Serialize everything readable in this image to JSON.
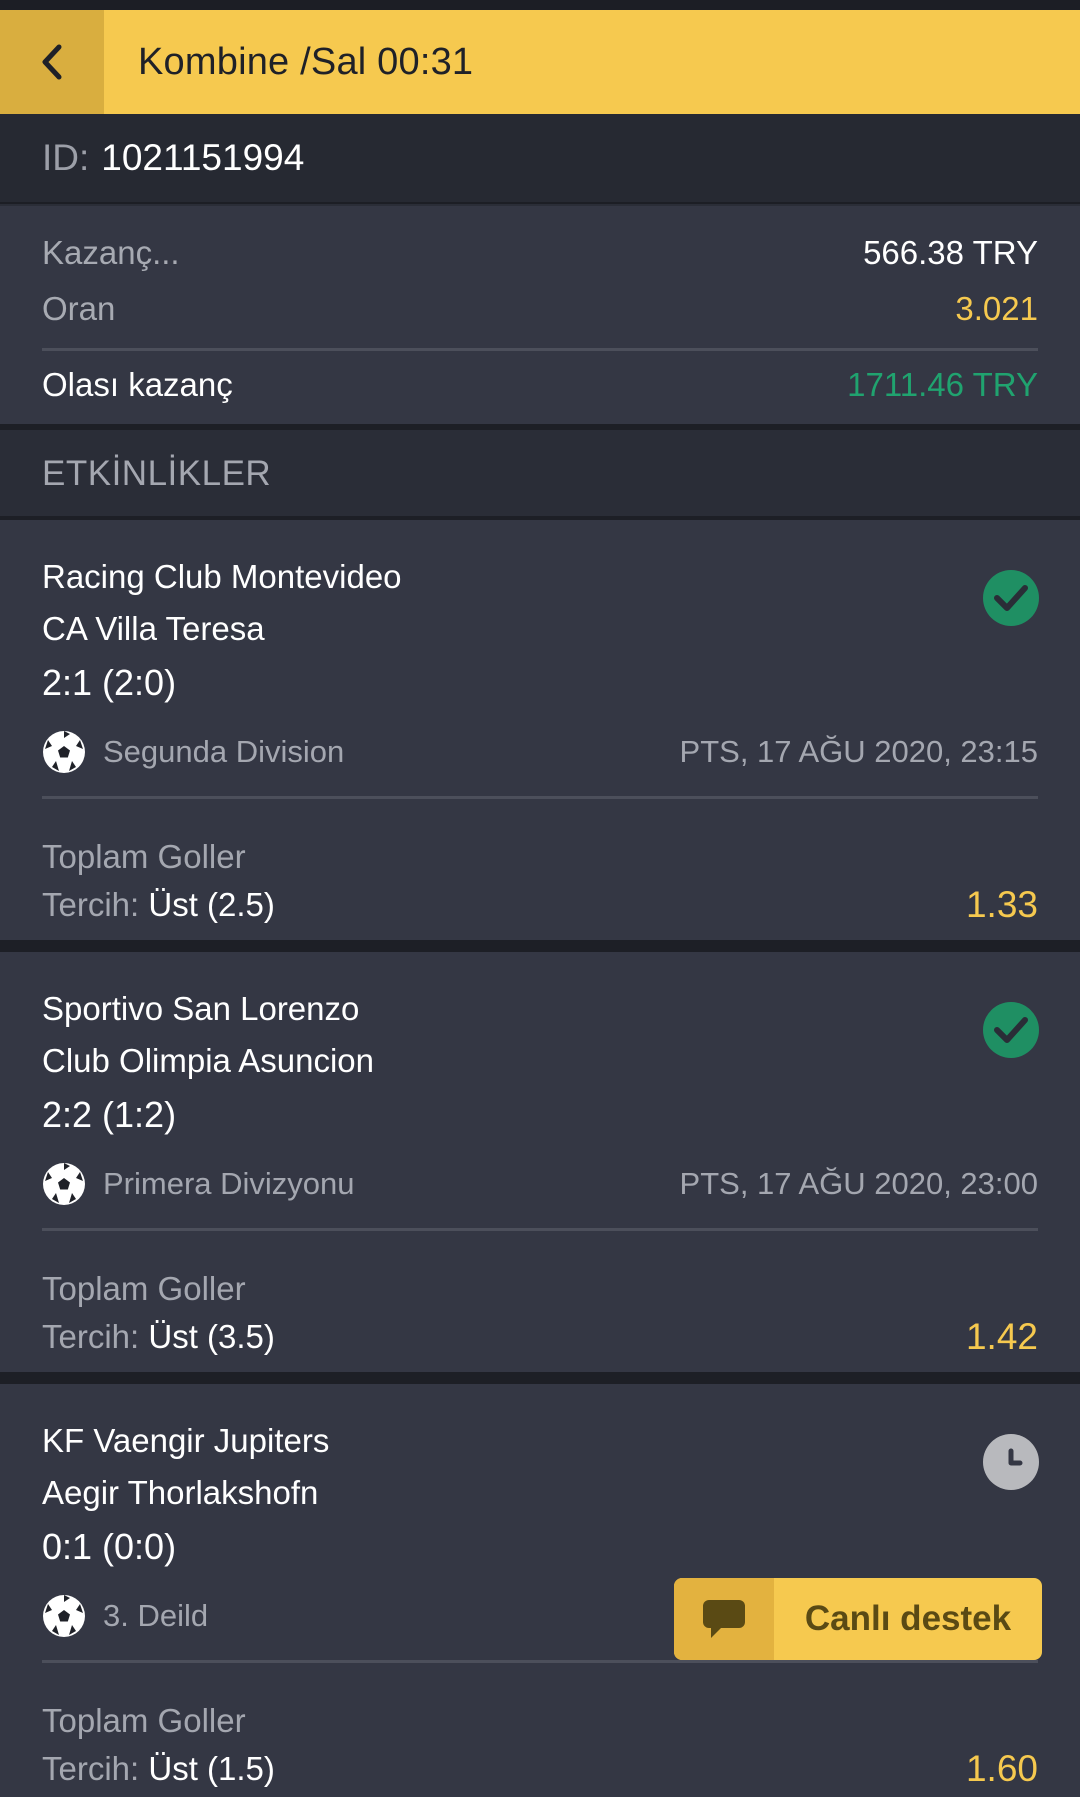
{
  "header": {
    "title": "Kombine /Sal 00:31",
    "back_icon": "chevron-left-icon"
  },
  "ticket": {
    "id_label": "ID:",
    "id_value": "1021151994"
  },
  "summary": {
    "stake_label": "Kazanç...",
    "stake_value": "566.38 TRY",
    "odds_label": "Oran",
    "odds_value": "3.021",
    "potential_label": "Olası kazanç",
    "potential_value": "1711.46 TRY"
  },
  "events_header": "ETKİNLİKLER",
  "events": [
    {
      "home": "Racing Club Montevideo",
      "away": "CA Villa Teresa",
      "score": "2:1 (2:0)",
      "status": "won",
      "status_icon": "check-icon",
      "sport_icon": "soccer-ball-icon",
      "league": "Segunda Division",
      "date": "PTS, 17 AĞU 2020, 23:15",
      "market": "Toplam Goller",
      "pick_label": "Tercih:",
      "pick_value": "Üst (2.5)",
      "odd": "1.33"
    },
    {
      "home": "Sportivo San Lorenzo",
      "away": "Club Olimpia Asuncion",
      "score": "2:2 (1:2)",
      "status": "won",
      "status_icon": "check-icon",
      "sport_icon": "soccer-ball-icon",
      "league": "Primera Divizyonu",
      "date": "PTS, 17 AĞU 2020, 23:00",
      "market": "Toplam Goller",
      "pick_label": "Tercih:",
      "pick_value": "Üst (3.5)",
      "odd": "1.42"
    },
    {
      "home": "KF Vaengir Jupiters",
      "away": "Aegir Thorlakshofn",
      "score": "0:1 (0:0)",
      "status": "pending",
      "status_icon": "clock-icon",
      "sport_icon": "soccer-ball-icon",
      "league": "3. Deild",
      "date": "",
      "market": "Toplam Goller",
      "pick_label": "Tercih:",
      "pick_value": "Üst (1.5)",
      "odd": "1.60"
    }
  ],
  "live_support": {
    "label": "Canlı destek",
    "icon": "chat-bubble-icon"
  },
  "colors": {
    "accent": "#f6c94f",
    "won": "#1f8f63",
    "pending": "#b8b9bd",
    "potential_win": "#20a36f",
    "odds": "#f6c94f"
  }
}
